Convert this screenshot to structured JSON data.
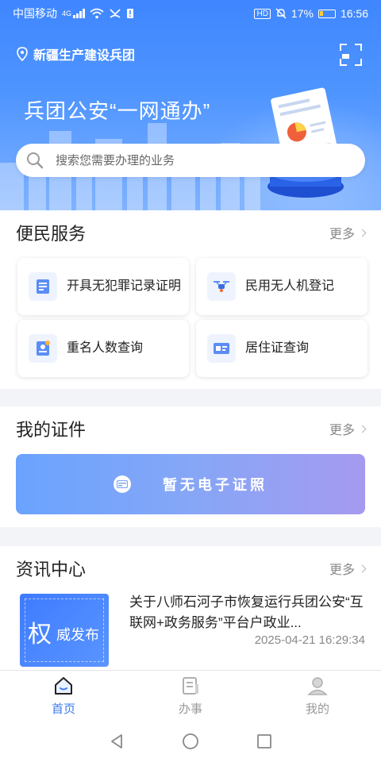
{
  "status_bar": {
    "carrier": "中国移动",
    "signal_tag": "4G",
    "hd": "HD",
    "battery": "17%",
    "time": "16:56"
  },
  "header": {
    "location": "新疆生产建设兵团",
    "slogan": "兵团公安“一网通办”",
    "search_placeholder": "搜索您需要办理的业务"
  },
  "services": {
    "title": "便民服务",
    "more": "更多",
    "items": [
      {
        "label": "开具无犯罪记录证明",
        "icon": "document-certificate-icon"
      },
      {
        "label": "民用无人机登记",
        "icon": "drone-icon"
      },
      {
        "label": "重名人数查询",
        "icon": "name-query-icon"
      },
      {
        "label": "居住证查询",
        "icon": "residence-card-icon"
      }
    ]
  },
  "certificates": {
    "title": "我的证件",
    "more": "更多",
    "empty_text": "暂无电子证照"
  },
  "news": {
    "title": "资讯中心",
    "more": "更多",
    "thumb_big": "权",
    "thumb_small": "威发布",
    "items": [
      {
        "title": "关于八师石河子市恢复运行兵团公安“互联网+政务服务”平台户政业...",
        "time": "2025-04-21 16:29:34"
      }
    ]
  },
  "tabs": [
    {
      "label": "首页",
      "icon": "home-icon",
      "active": true
    },
    {
      "label": "办事",
      "icon": "tasks-icon",
      "active": false
    },
    {
      "label": "我的",
      "icon": "profile-icon",
      "active": false
    }
  ],
  "colors": {
    "primary": "#3a7bf0",
    "hero_top": "#3f86ff",
    "cert_gradient_start": "#6aa3ff",
    "cert_gradient_end": "#a59af0"
  }
}
